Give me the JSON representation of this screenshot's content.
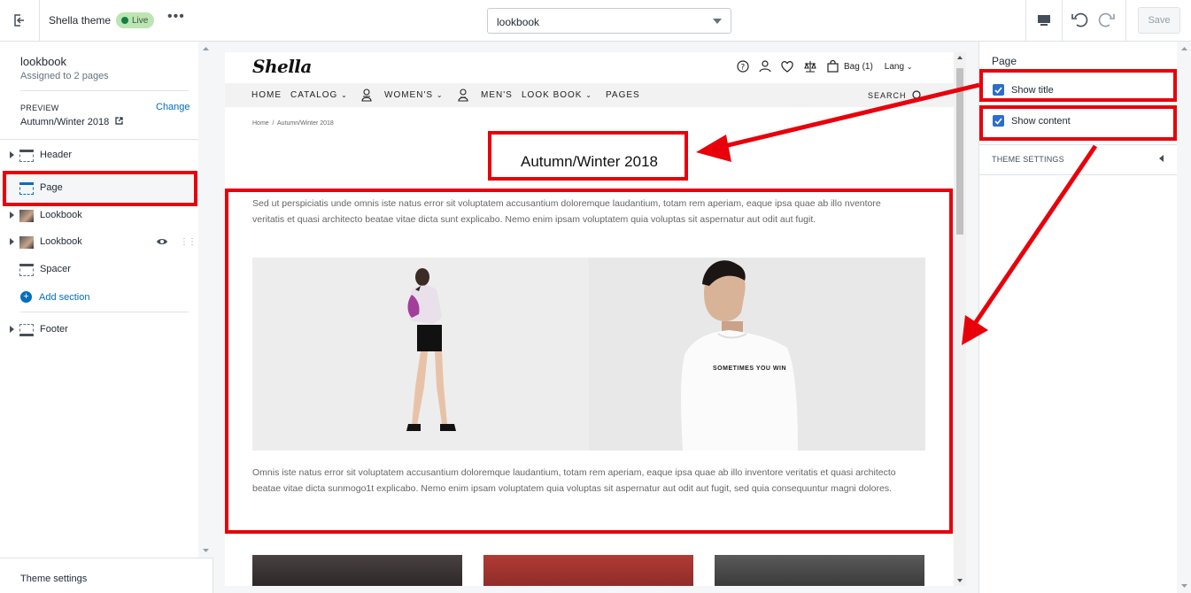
{
  "topbar": {
    "theme_name": "Shella theme",
    "status": "Live",
    "more": "•••",
    "page_select": "lookbook",
    "save": "Save"
  },
  "sidebar": {
    "title": "lookbook",
    "subtitle": "Assigned to 2 pages",
    "preview_label": "PREVIEW",
    "change": "Change",
    "preview_value": "Autumn/Winter 2018",
    "items": [
      {
        "label": "Header"
      },
      {
        "label": "Page"
      },
      {
        "label": "Lookbook"
      },
      {
        "label": "Lookbook"
      },
      {
        "label": "Spacer"
      }
    ],
    "add_section": "Add section",
    "footer": "Footer",
    "theme_settings": "Theme settings"
  },
  "store": {
    "logo": "Shella",
    "bag": "Bag (1)",
    "lang": "Lang",
    "nav": [
      "HOME",
      "CATALOG",
      "WOMEN'S",
      "MEN'S",
      "LOOK BOOK",
      "PAGES"
    ],
    "search": "SEARCH",
    "breadcrumb": "Home  /  Autumn/Winter 2018",
    "page_title": "Autumn/Winter 2018",
    "para1": " Sed ut perspiciatis unde omnis iste natus error sit voluptatem accusantium doloremque laudantium, totam rem aperiam, eaque ipsa quae ab illo nventore veritatis et quasi architecto beatae vitae dicta sunt explicabo. Nemo enim ipsam voluptatem quia voluptas sit aspernatur aut odit aut fugit.",
    "tshirt_text": "SOMETIMES YOU WIN",
    "para2": " Omnis iste natus error sit voluptatem accusantium doloremque laudantium, totam rem aperiam, eaque ipsa quae ab illo inventore veritatis et quasi architecto beatae vitae dicta sunmogo1t explicabo. Nemo enim ipsam voluptatem quia voluptas sit aspernatur aut odit aut fugit, sed quia consequuntur magni dolores."
  },
  "settings": {
    "title": "Page",
    "show_title": "Show title",
    "show_content": "Show content",
    "theme_settings": "THEME SETTINGS"
  },
  "annotation_color": "#e8000b"
}
